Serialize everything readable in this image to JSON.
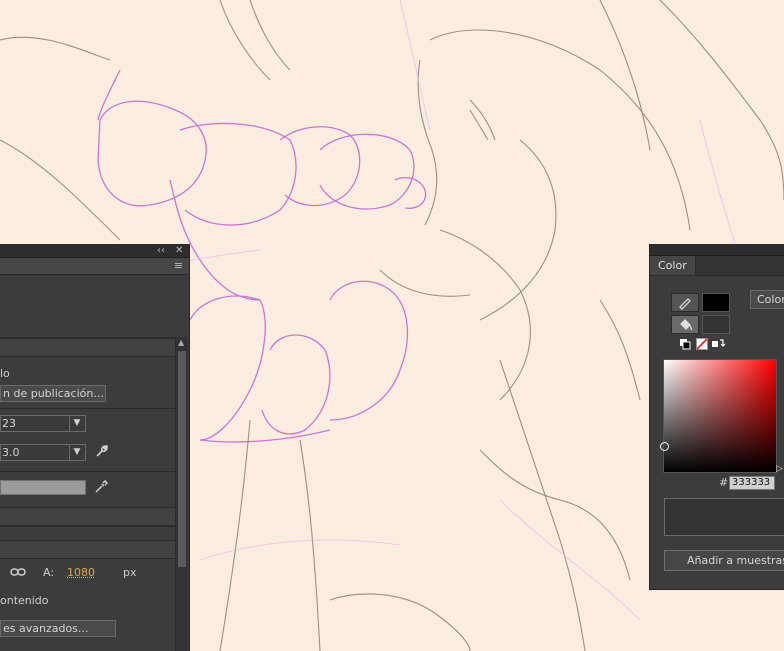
{
  "properties_panel": {
    "top_controls": {
      "collapse": "‹‹",
      "close": "✕"
    },
    "menu_glyph": "≡",
    "publish": {
      "label_tail": "lo",
      "settings_button": "n de publicación..."
    },
    "target_dropdown": "23",
    "script_dropdown": "3.0",
    "size": {
      "h_label": "A:",
      "h_value": "1080",
      "unit": "px"
    },
    "match_contents": "ontenido",
    "advanced_button": "es avanzados..."
  },
  "color_panel": {
    "tab_label": "Color",
    "mode_button": "Color",
    "hex_label": "#",
    "hex_value": "333333",
    "add_swatch_button": "Añadir a muestras",
    "stroke_color": "#000000",
    "fill_color": "#333333"
  },
  "colors": {
    "panel_bg": "#3c3c3c",
    "canvas_bg": "#fbeee0",
    "sketch_gray": "#8a7f78",
    "sketch_purple": "#c667d6",
    "highlight_orange": "#e6a23c"
  }
}
